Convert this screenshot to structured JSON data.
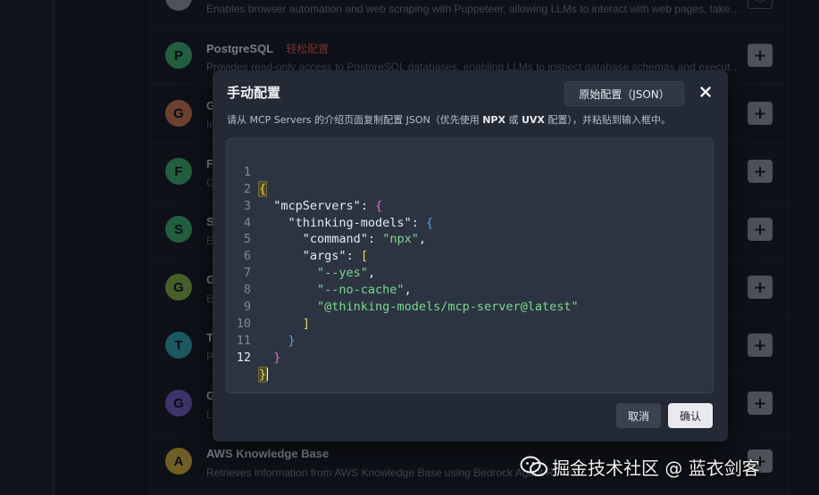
{
  "server_list": {
    "rows": [
      {
        "avatar": "",
        "title": "",
        "tag": "",
        "description": "Enables browser automation and web scraping with Puppeteer, allowing LLMs to interact with web pages, take screenshots, and execute JavaScript",
        "action": "settings",
        "avatar_color": "#8d9199"
      },
      {
        "avatar": "P",
        "title": "PostgreSQL",
        "tag": "轻松配置",
        "description": "Provides read-only access to PostgreSQL databases, enabling LLMs to inspect database schemas and execute read-only queries",
        "action": "+",
        "avatar_color": "#3aa86b"
      },
      {
        "avatar": "G",
        "title": "G",
        "tag": "",
        "description": "In",
        "action": "+",
        "avatar_color": "#c2714f"
      },
      {
        "avatar": "F",
        "title": "F",
        "tag": "",
        "description": "C",
        "action": "+",
        "avatar_color": "#3aa86b"
      },
      {
        "avatar": "S",
        "title": "S",
        "tag": "",
        "description": "E",
        "action": "+",
        "avatar_color": "#3aa86b"
      },
      {
        "avatar": "G",
        "title": "G",
        "tag": "",
        "description": "E",
        "action": "+",
        "avatar_color": "#7fa842"
      },
      {
        "avatar": "T",
        "title": "T",
        "tag": "",
        "description": "P",
        "action": "+",
        "avatar_color": "#2f9ba6"
      },
      {
        "avatar": "G",
        "title": "G",
        "tag": "",
        "description": "L",
        "action": "+",
        "avatar_color": "#6d58b8"
      },
      {
        "avatar": "A",
        "title": "AWS Knowledge Base",
        "tag": "",
        "description": "Retrieves information from AWS Knowledge Base using Bedrock Agent Runtime",
        "action": "+",
        "avatar_color": "#c9a83a"
      }
    ]
  },
  "modal": {
    "title": "手动配置",
    "raw_config_label": "原始配置（JSON）",
    "desc_prefix": "请从 MCP Servers 的介绍页面复制配置 JSON（优先使用 ",
    "desc_npx": "NPX",
    "desc_mid": " 或 ",
    "desc_uvx": "UVX",
    "desc_suffix": " 配置），并粘贴到输入框中。",
    "cancel_label": "取消",
    "confirm_label": "确认"
  },
  "editor": {
    "line_numbers": [
      "1",
      "2",
      "3",
      "4",
      "5",
      "6",
      "7",
      "8",
      "9",
      "10",
      "11",
      "12"
    ],
    "active_line": 12,
    "tokens": {
      "open_brace": "{",
      "mcp_key": "\"mcpServers\"",
      "thinking_key": "\"thinking-models\"",
      "command_key": "\"command\"",
      "command_val": "\"npx\"",
      "args_key": "\"args\"",
      "arg1": "\"--yes\"",
      "arg2": "\"--no-cache\"",
      "arg3": "\"@thinking-models/mcp-server@latest\"",
      "close_bracket": "]",
      "close_brace": "}"
    }
  },
  "watermark": {
    "text": "掘金技术社区 @ 蓝衣剑客"
  },
  "colors": {
    "string": "#7bd88f",
    "bracket_level1": "#f0d44a",
    "bracket_level2": "#d670d6",
    "bracket_level3": "#4aa3f0",
    "tag": "#d9534f"
  }
}
